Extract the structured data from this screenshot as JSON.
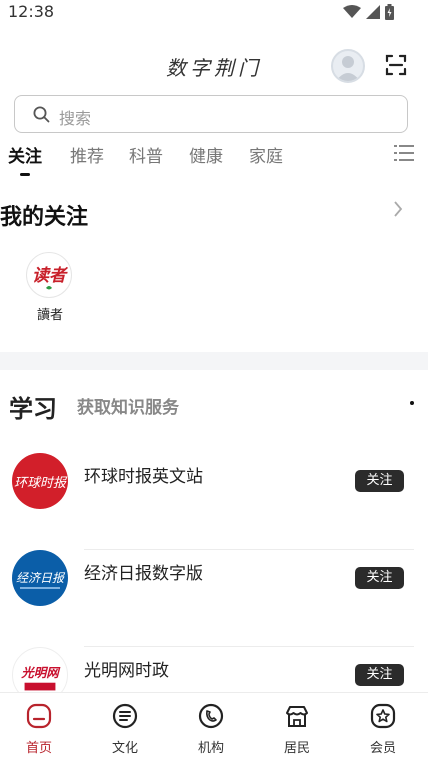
{
  "status_bar": {
    "time": "12:38"
  },
  "header": {
    "title": "数字荆门"
  },
  "search": {
    "placeholder": "搜索"
  },
  "tabs": [
    {
      "label": "关注",
      "active": true
    },
    {
      "label": "推荐"
    },
    {
      "label": "科普"
    },
    {
      "label": "健康"
    },
    {
      "label": "家庭"
    }
  ],
  "my_follows": {
    "title": "我的关注",
    "items": [
      {
        "name": "讀者",
        "logo_text": "读者"
      }
    ]
  },
  "study": {
    "title": "学习",
    "subtitle": "获取知识服务",
    "items": [
      {
        "name": "环球时报英文站",
        "button": "关注",
        "logo_text": "环球时报",
        "logo_color": "#d21f2a"
      },
      {
        "name": "经济日报数字版",
        "button": "关注",
        "logo_text": "经济日报",
        "logo_color": "#0b5ea8"
      },
      {
        "name": "光明网时政",
        "button": "关注",
        "logo_text": "光明网",
        "logo_color": "#c8102e"
      }
    ]
  },
  "bottom_nav": [
    {
      "label": "首页",
      "icon": "home-icon",
      "active": true
    },
    {
      "label": "文化",
      "icon": "culture-icon"
    },
    {
      "label": "机构",
      "icon": "institution-icon"
    },
    {
      "label": "居民",
      "icon": "residents-icon"
    },
    {
      "label": "会员",
      "icon": "member-icon"
    }
  ],
  "colors": {
    "accent": "#b8232c",
    "button_dark": "#2b2b2b"
  }
}
